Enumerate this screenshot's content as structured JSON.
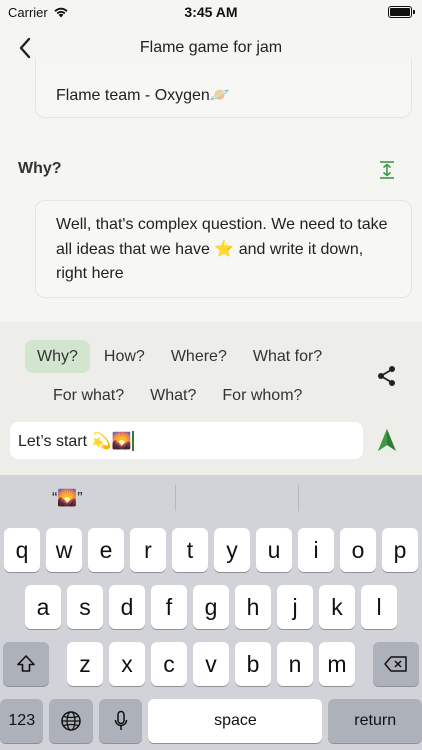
{
  "status_bar": {
    "carrier": "Carrier",
    "time": "3:45 AM"
  },
  "nav": {
    "title": "Flame game for jam",
    "back_icon": "chevron-left-icon"
  },
  "top_card": {
    "text": "Flame team - Oxygen🪐"
  },
  "section": {
    "heading": "Why?",
    "expand_icon": "expand-vertical-icon",
    "answer": "Well, that's complex question. We need to take all ideas that we have ⭐ and write it down, right here"
  },
  "chips": {
    "row1": [
      "Why?",
      "How?",
      "Where?",
      "What for?"
    ],
    "row2": [
      "For what?",
      "What?",
      "For whom?"
    ],
    "active": "Why?"
  },
  "composer": {
    "input_value": "Let’s start 💫🌄",
    "share_icon": "share-icon",
    "send_icon": "send-arrow-icon"
  },
  "keyboard": {
    "suggestion": "“🌄”",
    "row1": [
      "q",
      "w",
      "e",
      "r",
      "t",
      "y",
      "u",
      "i",
      "o",
      "p"
    ],
    "row2": [
      "a",
      "s",
      "d",
      "f",
      "g",
      "h",
      "j",
      "k",
      "l"
    ],
    "row3": [
      "z",
      "x",
      "c",
      "v",
      "b",
      "n",
      "m"
    ],
    "numbers_label": "123",
    "space_label": "space",
    "return_label": "return"
  },
  "colors": {
    "accent": "#2e7d32",
    "chip_active": "#d2e6cf"
  }
}
